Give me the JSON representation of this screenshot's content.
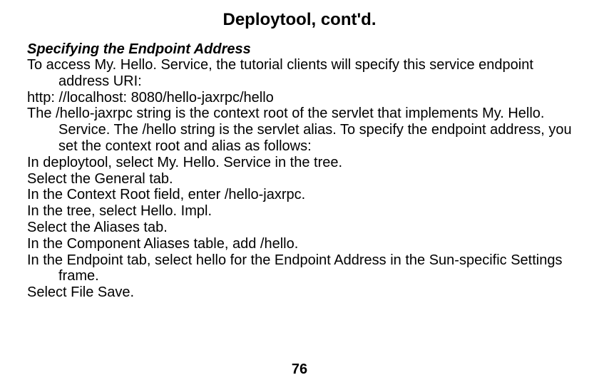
{
  "title": "Deploytool, cont'd.",
  "subheading": "Specifying the Endpoint Address",
  "paragraphs": [
    "To access My. Hello. Service, the tutorial clients will specify this service endpoint address URI:",
    "http: //localhost: 8080/hello-jaxrpc/hello",
    "The /hello-jaxrpc string is the context root of the servlet that implements My. Hello. Service. The /hello string is the servlet alias. To specify the endpoint address, you set the context root and alias as follows:",
    "In deploytool, select My. Hello. Service in the tree.",
    "Select the General tab.",
    "In the Context Root field, enter /hello-jaxrpc.",
    "In the tree, select Hello. Impl.",
    "Select the Aliases tab.",
    "In the Component Aliases table, add /hello.",
    "In the Endpoint tab, select hello for the Endpoint Address in the Sun-specific Settings frame.",
    "Select File Save."
  ],
  "page_number": "76"
}
